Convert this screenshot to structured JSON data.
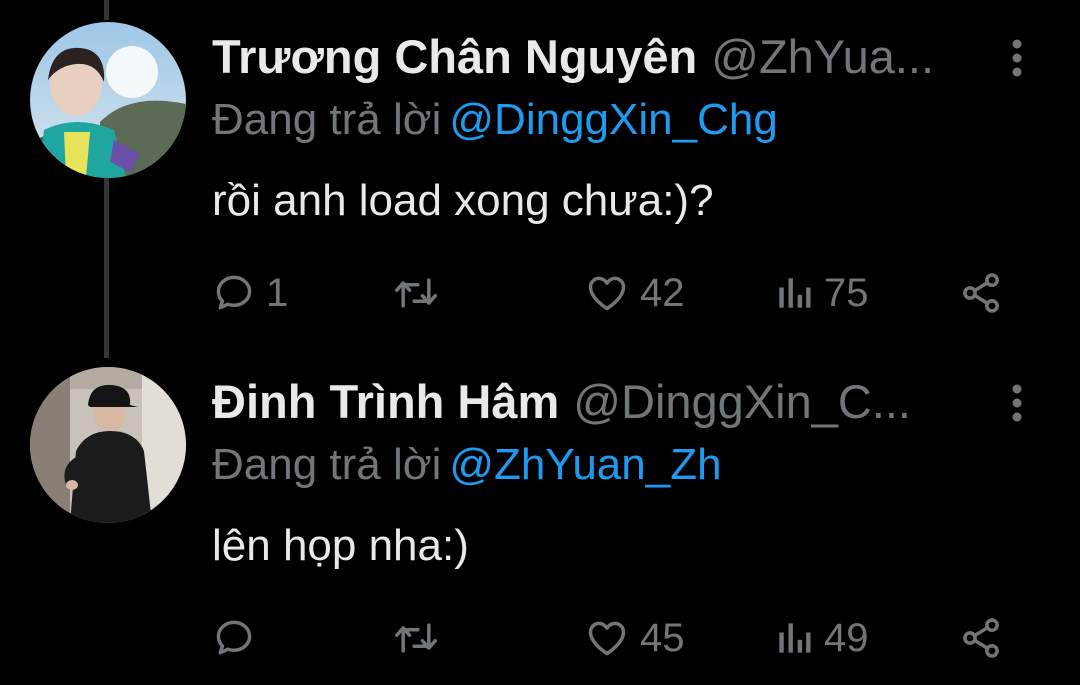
{
  "colors": {
    "background": "#000000",
    "text_primary": "#e7e9ea",
    "text_secondary": "#71767b",
    "accent": "#1d9bf0",
    "thread_line": "#333639"
  },
  "icons": {
    "more": "vertical-ellipsis-icon",
    "reply": "speech-bubble-icon",
    "retweet": "retweet-arrows-icon",
    "like": "heart-icon",
    "views": "bar-chart-icon",
    "share": "share-nodes-icon"
  },
  "tweets": [
    {
      "display_name": "Trương Chân Nguyên",
      "handle": "@ZhYua...",
      "reply_prefix": "Đang trả lời",
      "reply_to": "@DinggXin_Chg",
      "text": "rồi anh load xong chưa:)?",
      "reply_count": "1",
      "retweet_count": "",
      "like_count": "42",
      "view_count": "75"
    },
    {
      "display_name": "Đinh Trình Hâm",
      "handle": "@DinggXin_C...",
      "reply_prefix": "Đang trả lời",
      "reply_to": "@ZhYuan_Zh",
      "text": "lên họp nha:)",
      "reply_count": "",
      "retweet_count": "",
      "like_count": "45",
      "view_count": "49"
    }
  ]
}
